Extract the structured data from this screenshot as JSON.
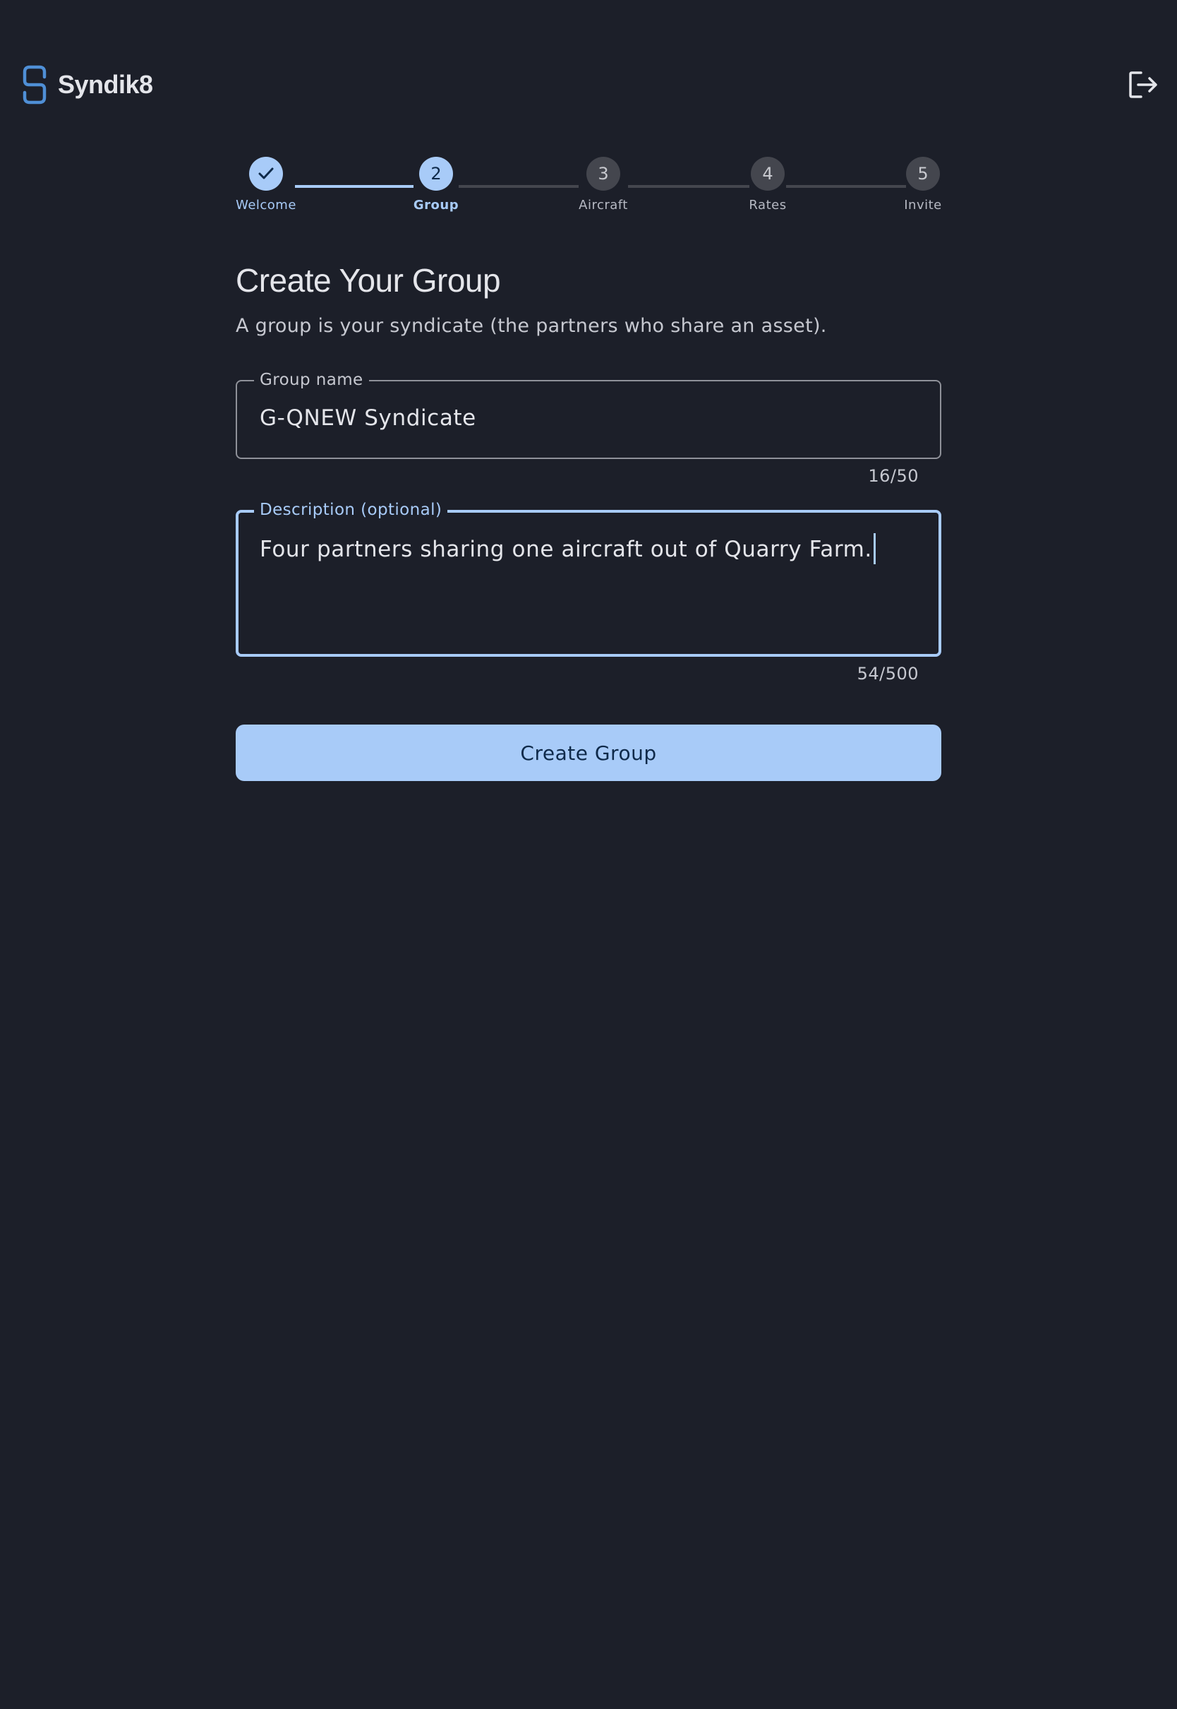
{
  "app": {
    "brand_name": "Syndik8",
    "logo_icon": "syndik8-logo-icon",
    "logout_icon": "logout-icon"
  },
  "stepper": {
    "steps": [
      {
        "number": "",
        "label": "Welcome",
        "state": "done"
      },
      {
        "number": "2",
        "label": "Group",
        "state": "current"
      },
      {
        "number": "3",
        "label": "Aircraft",
        "state": "pending"
      },
      {
        "number": "4",
        "label": "Rates",
        "state": "pending"
      },
      {
        "number": "5",
        "label": "Invite",
        "state": "pending"
      }
    ]
  },
  "form": {
    "title": "Create Your Group",
    "subtitle": "A group is your syndicate (the partners who share an asset).",
    "group_name": {
      "label": "Group name",
      "value": "G-QNEW Syndicate",
      "counter": "16/50"
    },
    "description": {
      "label": "Description (optional)",
      "value": "Four partners sharing one aircraft out of Quarry Farm.",
      "counter": "54/500"
    },
    "submit_label": "Create Group"
  },
  "colors": {
    "background": "#1c1f29",
    "accent": "#a8cbf8",
    "pending_step": "#44464e",
    "logo_blue": "#4f8fd6"
  }
}
